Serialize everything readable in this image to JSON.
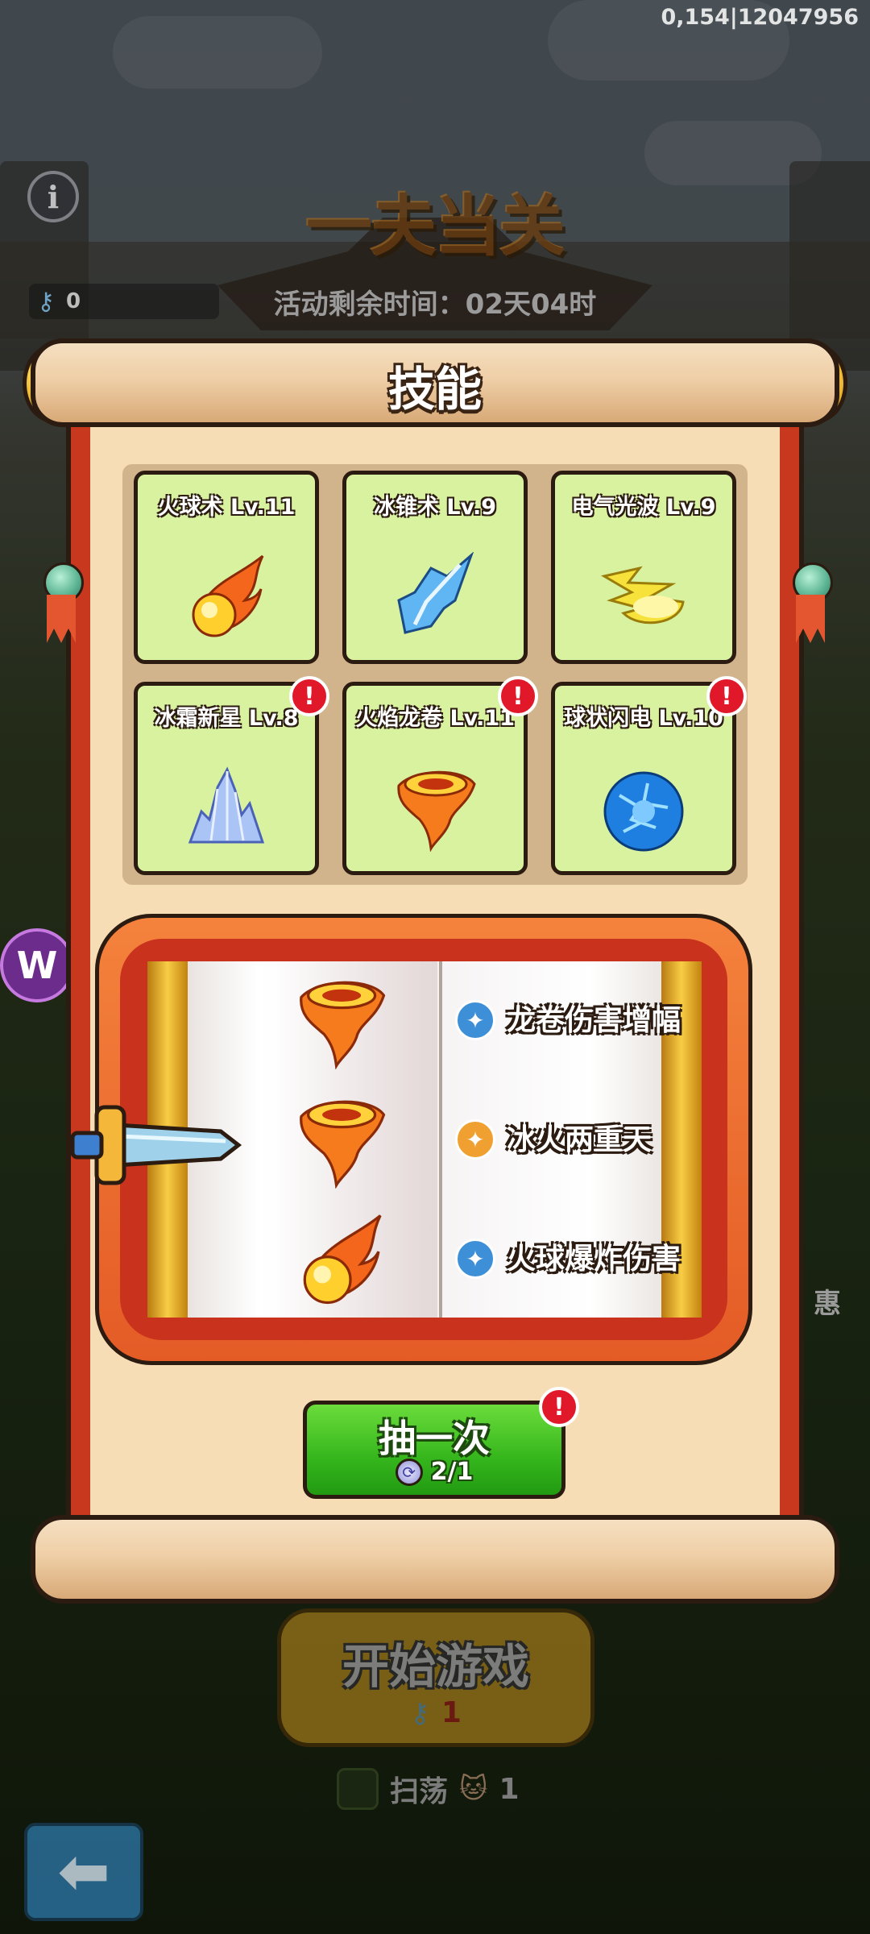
{
  "debug": {
    "text": "0,154|12047956"
  },
  "hud": {
    "info_icon": "info-icon",
    "key_count": "0"
  },
  "event": {
    "title": "一夫当关",
    "timer": "活动剩余时间：02天04时"
  },
  "panel": {
    "title": "技能",
    "skills": [
      {
        "label": "火球术 Lv.11",
        "icon": "fireball-icon",
        "alert": false
      },
      {
        "label": "冰锥术 Lv.9",
        "icon": "ice-shard-icon",
        "alert": false
      },
      {
        "label": "电气光波 Lv.9",
        "icon": "lightning-wave-icon",
        "alert": false
      },
      {
        "label": "冰霜新星 Lv.8",
        "icon": "ice-crystal-icon",
        "alert": true
      },
      {
        "label": "火焰龙卷 Lv.11",
        "icon": "fire-tornado-icon",
        "alert": true
      },
      {
        "label": "球状闪电 Lv.10",
        "icon": "lightning-orb-icon",
        "alert": true
      }
    ],
    "slot": {
      "rows": [
        {
          "icon": "fire-tornado-icon",
          "effect": "龙卷伤害增幅",
          "badge": "blue"
        },
        {
          "icon": "fire-tornado-icon",
          "effect": "冰火两重天",
          "badge": "gold"
        },
        {
          "icon": "fireball-icon",
          "effect": "火球爆炸伤害",
          "badge": "blue"
        }
      ]
    },
    "draw": {
      "label": "抽一次",
      "cost": "2/1",
      "alert": "!"
    }
  },
  "bottom": {
    "start_label": "开始游戏",
    "start_cost": "1",
    "sweep_label": "扫荡",
    "sweep_count": "1"
  },
  "side": {
    "right_label": "惠"
  },
  "colors": {
    "card_green": "#d9f2a0",
    "panel_paper": "#f7ddb5",
    "scroll_red": "#c8381f",
    "button_green": "#35b61c",
    "alert_red": "#e0182a",
    "badge_blue": "#3d8fd8",
    "badge_gold": "#f0a030"
  }
}
